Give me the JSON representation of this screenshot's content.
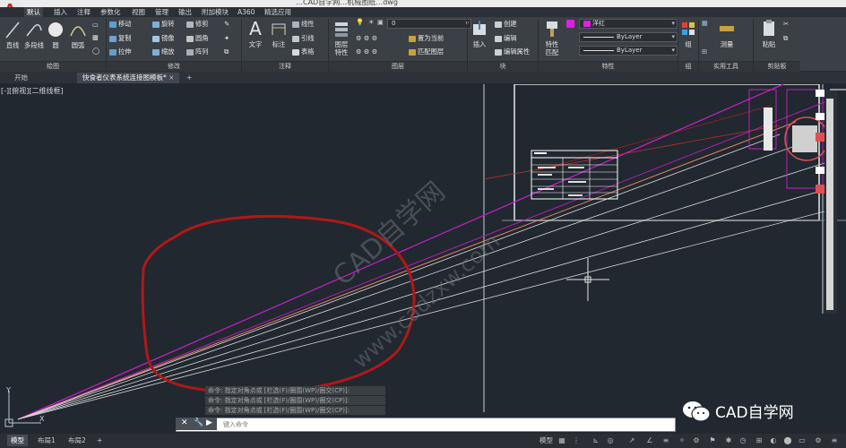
{
  "app": {
    "logo": "A",
    "title_text": "…CAD自学网…机械图纸…dwg"
  },
  "ribbon_tabs": [
    "默认",
    "插入",
    "注释",
    "参数化",
    "视图",
    "管理",
    "输出",
    "附加模块",
    "A360",
    "精选应用"
  ],
  "panels": {
    "draw": {
      "title": "绘图",
      "line": "直线",
      "polyline": "多段线",
      "circle": "圆",
      "arc": "圆弧"
    },
    "modify": {
      "title": "修改",
      "items": [
        "移动",
        "旋转",
        "修剪",
        "复制",
        "镜像",
        "圆角",
        "拉伸",
        "缩放",
        "阵列"
      ]
    },
    "annotation": {
      "title": "注释",
      "text": "文字",
      "dimension": "标注",
      "linear": "线性",
      "leader": "引线",
      "table": "表格"
    },
    "layers": {
      "title": "图层",
      "layer_props": "图层特性",
      "current_layer": "0",
      "make_current": "置为当前",
      "match_layer": "匹配图层"
    },
    "block": {
      "title": "块",
      "insert": "插入",
      "create": "创建",
      "edit": "编辑",
      "edit_attr": "编辑属性"
    },
    "properties": {
      "title": "特性",
      "match": "特性匹配",
      "color": "洋红",
      "linetype": "ByLayer",
      "lineweight": "ByLayer"
    },
    "groups": {
      "title": "组",
      "group": "组"
    },
    "utilities": {
      "title": "实用工具",
      "measure": "测量"
    },
    "clipboard": {
      "title": "剪贴板",
      "paste": "粘贴"
    }
  },
  "doc_tabs": {
    "start": "开始",
    "drawing": "快食者仪表系统连接图模板*",
    "add": "+"
  },
  "viewport_label": "[-][俯视][二维线框]",
  "command": {
    "history": [
      "命令: 指定对角点或 [栏选(F)/圈围(WP)/圈交(CP)]:",
      "命令: 指定对角点或 [栏选(F)/圈围(WP)/圈交(CP)]:",
      "命令: 指定对角点或 [栏选(F)/圈围(WP)/圈交(CP)]:"
    ],
    "placeholder": "键入命令"
  },
  "layout_tabs": [
    "模型",
    "布局1",
    "布局2"
  ],
  "status_model": "模型",
  "watermark": {
    "diagonal": "CAD自学网",
    "url": "www.cadzxw.com",
    "badge": "CAD自学网"
  },
  "colors": {
    "canvas": "#212830",
    "magenta": "#c020c0",
    "red_line": "#e05050",
    "red_annotation": "#b01818",
    "ribbon": "#3b4046"
  }
}
